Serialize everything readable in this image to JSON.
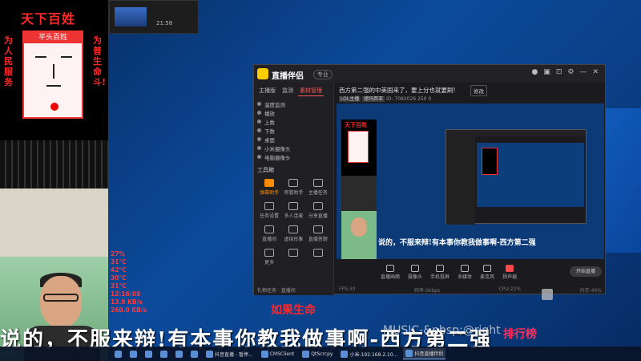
{
  "poster": {
    "title": "天下百姓",
    "cap": "平头百姓",
    "left_slogan": "为人民服务",
    "right_slogan": "为普生命斗!"
  },
  "stats": [
    "27%",
    "31°C",
    "42°C",
    "30°C",
    "31°C",
    "12:16:08",
    "13.9 KB/s",
    "260.0 KB/s"
  ],
  "mini_player": {
    "time": "21:58"
  },
  "app": {
    "name": "直播伴侣",
    "badge": "专业",
    "sidebar_tabs": [
      "主播版",
      "监测",
      "素材管理"
    ],
    "sources": [
      "温度监测",
      "播放",
      "上数",
      "下数",
      "桌面",
      "小米摄像头",
      "电脑摄像头"
    ],
    "tools_title": "工具箱",
    "tools": [
      {
        "label": "弹幕助手",
        "hot": true
      },
      {
        "label": "房管助手",
        "hot": false
      },
      {
        "label": "主播任务",
        "hot": false
      },
      {
        "label": "任务设置",
        "hot": false
      },
      {
        "label": "多人连麦",
        "hot": false
      },
      {
        "label": "分享直播",
        "hot": false
      },
      {
        "label": "直播间",
        "hot": false
      },
      {
        "label": "虚拟形象",
        "hot": false
      },
      {
        "label": "直播答题",
        "hot": false
      },
      {
        "label": "更多",
        "hot": false
      },
      {
        "label": "",
        "hot": false
      },
      {
        "label": "",
        "hot": false
      }
    ],
    "room_title": "西方第二强的中美国来了，要上分也就要刷!",
    "room_edit": "修改",
    "room_meta": {
      "tag1": "LOL主播",
      "tag2": "德玛西亚",
      "id": "ID: 7092026",
      "viewers": "250",
      "likes": "0"
    },
    "canvas_sub": "说的，不服来辩!有本事你教我做事啊-西方第二强",
    "canvas_poster_title": "天下百姓",
    "controls": [
      {
        "label": "直播画面",
        "red": false
      },
      {
        "label": "摄像头",
        "red": false
      },
      {
        "label": "手机投屏",
        "red": false
      },
      {
        "label": "多媒体",
        "red": false
      },
      {
        "label": "麦克风",
        "red": false
      },
      {
        "label": "扬声器",
        "red": true
      }
    ],
    "go_live": "开始直播",
    "status_left": "礼物任务 · 直播间",
    "status_items": [
      "FPS:30",
      "码率:0kbps",
      "CPU:22%",
      "内存:40%"
    ]
  },
  "overlay": {
    "life_label": "如果生命",
    "big_sub": "说的，不服来辩!有本事你教我做事啊-西方第二强",
    "watermark": "MUSIC-&nbsp;@right",
    "ranking": "排行榜"
  },
  "taskbar": {
    "items": [
      {
        "label": "",
        "active": false
      },
      {
        "label": "",
        "active": false
      },
      {
        "label": "",
        "active": false
      },
      {
        "label": "",
        "active": false
      },
      {
        "label": "",
        "active": false
      },
      {
        "label": "",
        "active": false
      },
      {
        "label": "抖音直播 - 暂停...",
        "active": false
      },
      {
        "label": "CMSClient",
        "active": false
      },
      {
        "label": "QtScrcpy",
        "active": false
      },
      {
        "label": "小米-192.168.2.10...",
        "active": false
      },
      {
        "label": "抖音直播伴侣",
        "active": true
      }
    ]
  }
}
